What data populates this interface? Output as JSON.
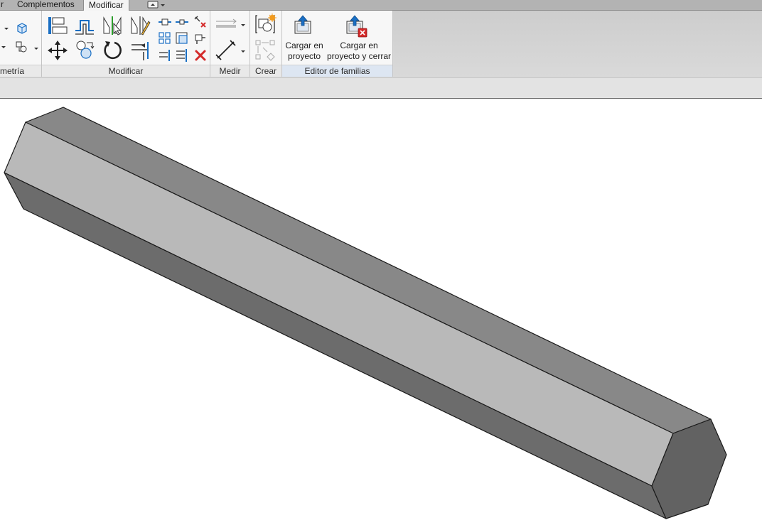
{
  "tabs": {
    "partial": "r",
    "complementos": "Complementos",
    "modificar": "Modificar"
  },
  "panels": {
    "geometria": "metría",
    "modificar": "Modificar",
    "medir": "Medir",
    "crear": "Crear",
    "editor": "Editor de familias"
  },
  "buttons": {
    "load_line1": "Cargar en",
    "load_line2": "proyecto",
    "load_close_line1": "Cargar en",
    "load_close_line2": "proyecto y cerrar"
  },
  "colors": {
    "face_top": "#888888",
    "face_front": "#b9b9b9",
    "face_bottom": "#6c6c6c",
    "face_end": "#626262",
    "accent_blue": "#1a6fc4",
    "delete_red": "#d42a2a"
  }
}
